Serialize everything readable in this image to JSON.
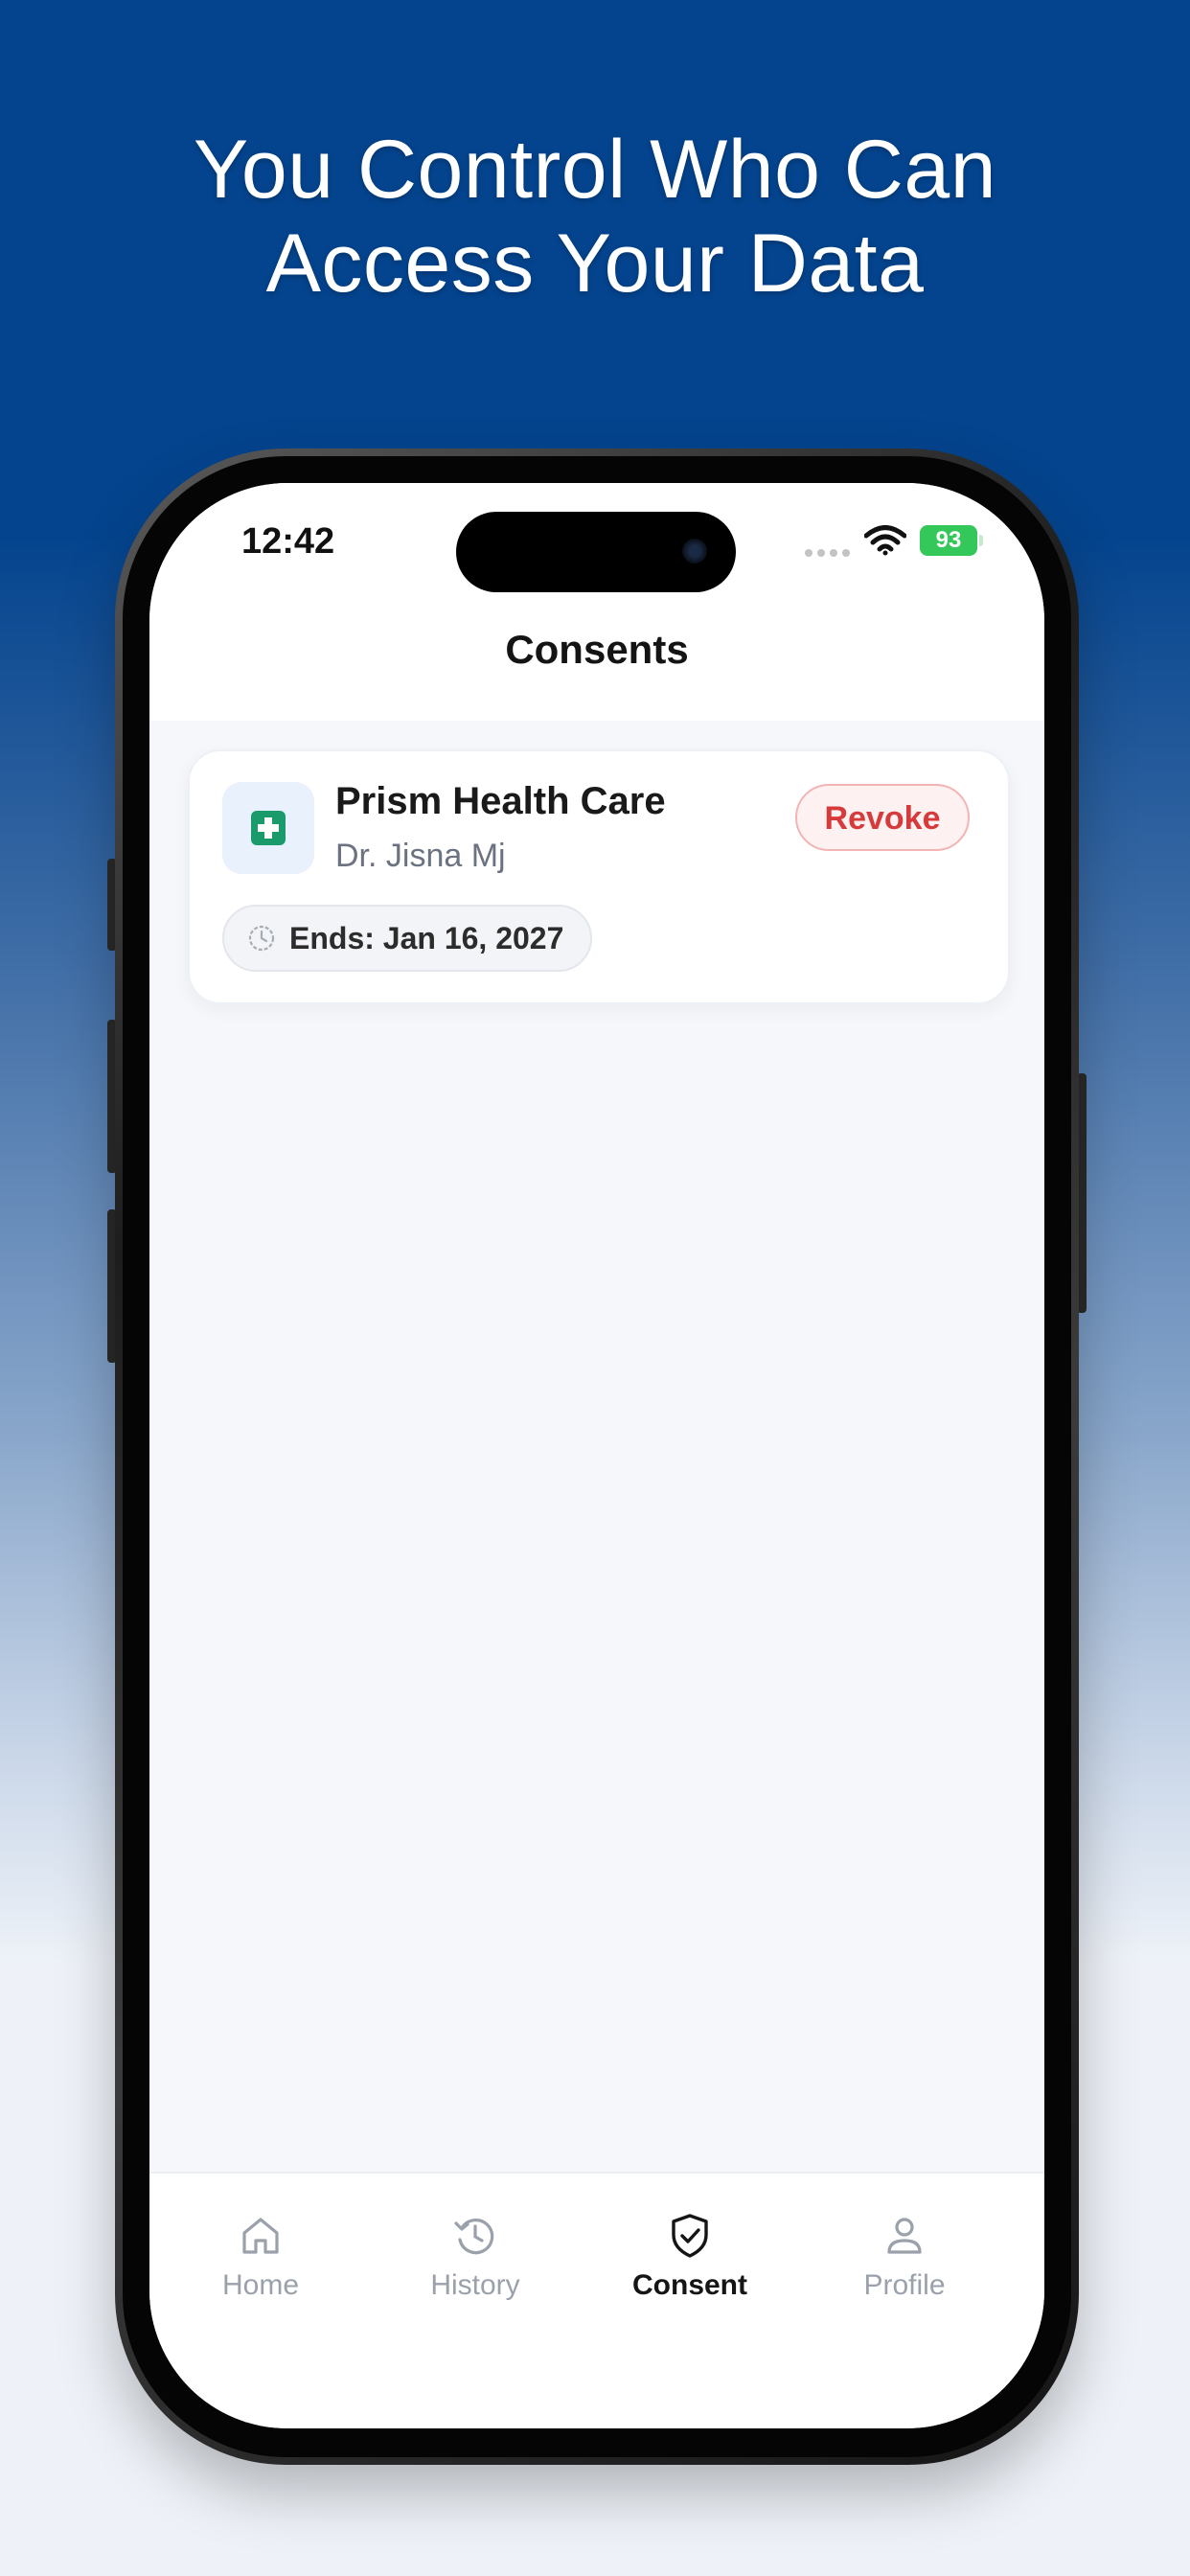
{
  "headline": {
    "line1": "You Control Who Can",
    "line2": "Access Your Data"
  },
  "status_bar": {
    "time": "12:42",
    "battery": "93"
  },
  "screen": {
    "title": "Consents"
  },
  "consents": [
    {
      "provider": "Prism Health Care",
      "doctor": "Dr. Jisna Mj",
      "action_label": "Revoke",
      "ends": "Ends: Jan 16, 2027"
    }
  ],
  "tabs": [
    {
      "label": "Home",
      "icon": "home-icon",
      "active": false
    },
    {
      "label": "History",
      "icon": "history-icon",
      "active": false
    },
    {
      "label": "Consent",
      "icon": "shield-check-icon",
      "active": true
    },
    {
      "label": "Profile",
      "icon": "person-icon",
      "active": false
    }
  ],
  "colors": {
    "background_top": "#04448e",
    "revoke_red": "#d63a3a",
    "medical_green": "#1b9a6c",
    "battery_green": "#34c759"
  }
}
